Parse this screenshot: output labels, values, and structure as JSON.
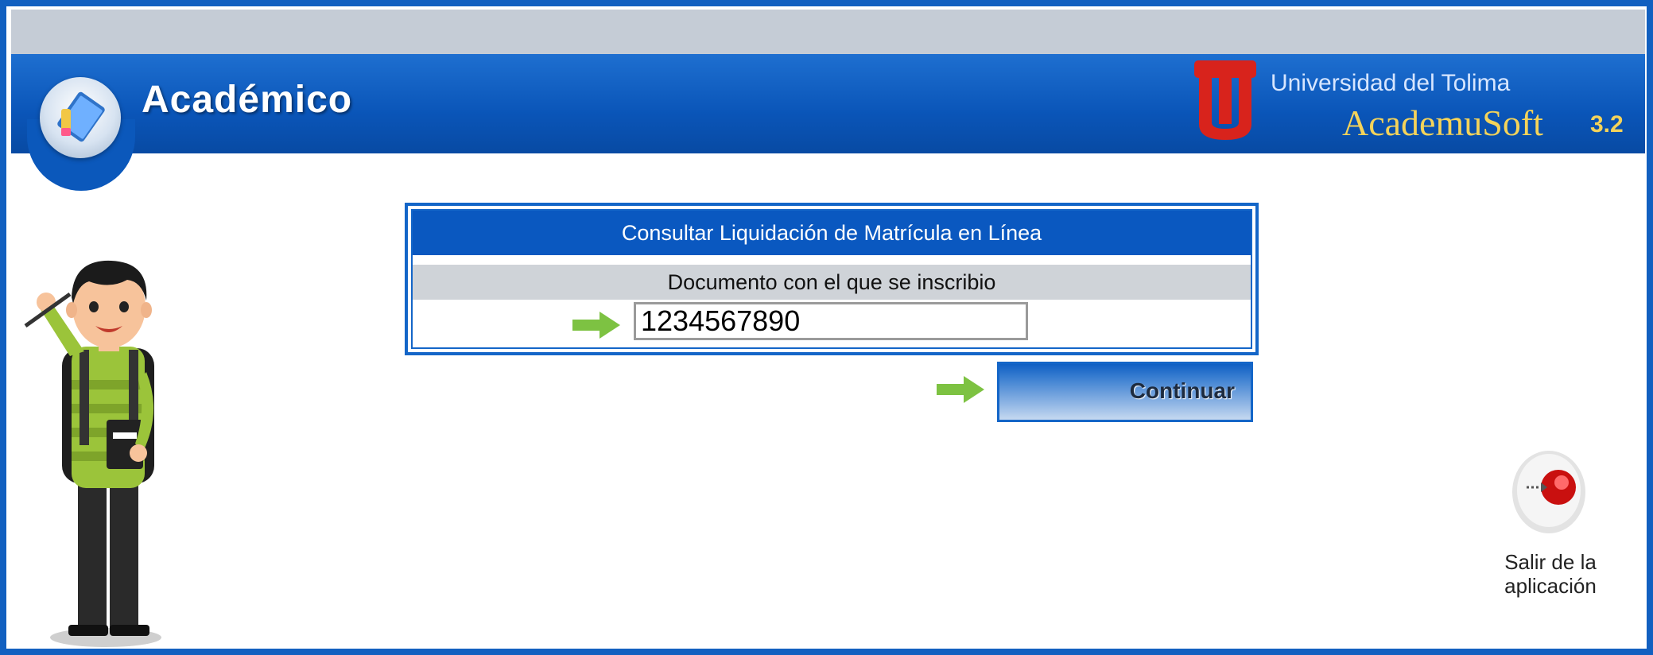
{
  "app": {
    "title": "Académico",
    "university": "Universidad del Tolima",
    "product": "AcademuSoft",
    "product_version": "3.2"
  },
  "form": {
    "title": "Consultar Liquidación de Matrícula en Línea",
    "document_label": "Documento con el que se inscribio",
    "document_value": "1234567890",
    "continue_label": "Continuar"
  },
  "exit": {
    "label_line1": "Salir de la",
    "label_line2": "aplicación"
  },
  "colors": {
    "header_blue": "#0a55b8",
    "arrow_green": "#7dc242",
    "brand_red": "#d8231c",
    "brand_gold": "#f4d35a"
  },
  "icons": [
    "app-book-icon",
    "university-logo-icon",
    "arrow-right-icon",
    "exit-app-icon",
    "student-illustration"
  ]
}
